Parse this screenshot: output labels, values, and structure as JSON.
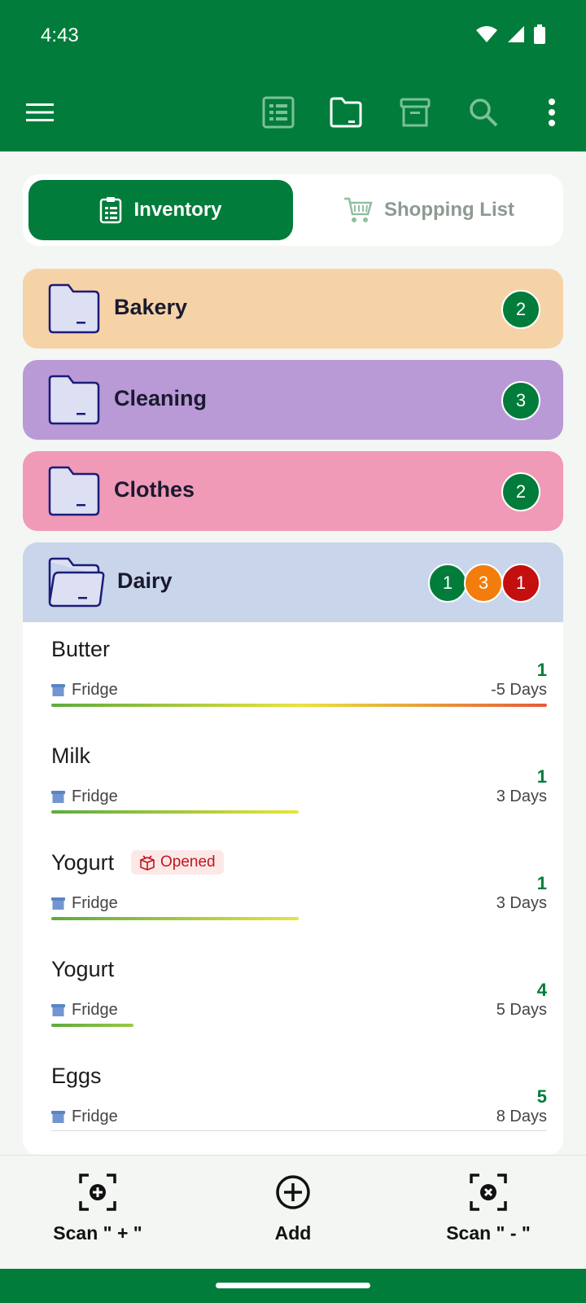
{
  "status": {
    "time": "4:43"
  },
  "appbar": {
    "icons": [
      "menu-icon",
      "list-view-icon",
      "folder-view-icon",
      "archive-icon",
      "search-icon",
      "more-vert-icon"
    ]
  },
  "tabs": {
    "inventory": "Inventory",
    "shopping": "Shopping List"
  },
  "categories": [
    {
      "name": "Bakery",
      "count": "2",
      "color": "#f6d3a7"
    },
    {
      "name": "Cleaning",
      "count": "3",
      "color": "#b99ad7"
    },
    {
      "name": "Clothes",
      "count": "2",
      "color": "#f09ab8"
    }
  ],
  "dairy": {
    "name": "Dairy",
    "color": "#c8d5ea",
    "counts": {
      "green": "1",
      "orange": "3",
      "red": "1"
    },
    "items": [
      {
        "name": "Butter",
        "location": "Fridge",
        "qty": "1",
        "days": "-5 Days",
        "freshness": 1.0
      },
      {
        "name": "Milk",
        "location": "Fridge",
        "qty": "1",
        "days": "3 Days",
        "freshness": 0.5,
        "opened": false
      },
      {
        "name": "Yogurt",
        "location": "Fridge",
        "qty": "1",
        "days": "3 Days",
        "freshness": 0.5,
        "opened_label": "Opened"
      },
      {
        "name": "Yogurt",
        "location": "Fridge",
        "qty": "4",
        "days": "5 Days",
        "freshness": 0.17
      },
      {
        "name": "Eggs",
        "location": "Fridge",
        "qty": "5",
        "days": "8 Days",
        "freshness": 0
      }
    ]
  },
  "bottom": {
    "scan_plus": "Scan \" + \"",
    "add": "Add",
    "scan_minus": "Scan \" - \""
  },
  "colors": {
    "brand": "#017c3a",
    "orange": "#f27d0c",
    "red": "#c40f0f",
    "folder_stroke": "#1b1b7a",
    "folder_fill": "#dde0f3"
  }
}
